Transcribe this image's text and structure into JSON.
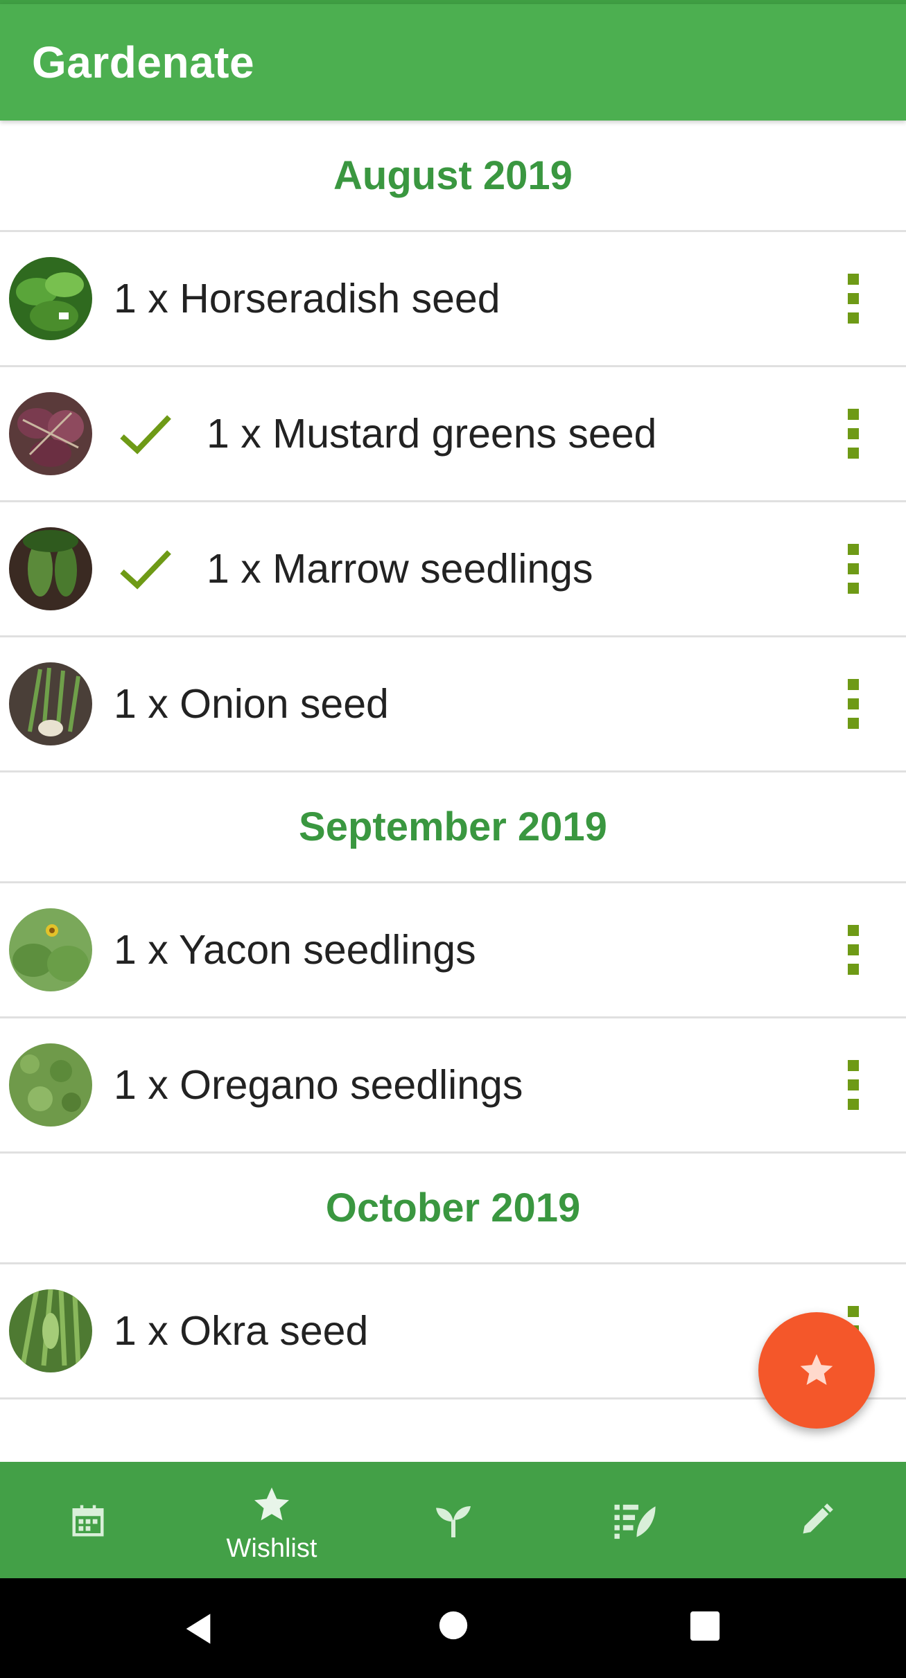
{
  "app": {
    "title": "Gardenate"
  },
  "sections": [
    {
      "month": "August 2019",
      "items": [
        {
          "label": "1 x Horseradish seed",
          "done": false
        },
        {
          "label": "1 x Mustard greens seed",
          "done": true
        },
        {
          "label": "1 x Marrow seedlings",
          "done": true
        },
        {
          "label": "1 x Onion seed",
          "done": false
        }
      ]
    },
    {
      "month": "September 2019",
      "items": [
        {
          "label": "1 x Yacon seedlings",
          "done": false
        },
        {
          "label": "1 x Oregano seedlings",
          "done": false
        }
      ]
    },
    {
      "month": "October 2019",
      "items": [
        {
          "label": "1 x Okra seed",
          "done": false
        }
      ]
    }
  ],
  "bottom_nav": {
    "items": [
      {
        "icon": "calendar-icon",
        "label": ""
      },
      {
        "icon": "star-icon",
        "label": "Wishlist",
        "active": true
      },
      {
        "icon": "sprout-icon",
        "label": ""
      },
      {
        "icon": "plant-list-icon",
        "label": ""
      },
      {
        "icon": "pencil-icon",
        "label": ""
      }
    ]
  },
  "colors": {
    "app_bar": "#4caf50",
    "bottom_nav": "#43a047",
    "month_text": "#3a9740",
    "check": "#6e9a16",
    "fab": "#f4572a"
  }
}
